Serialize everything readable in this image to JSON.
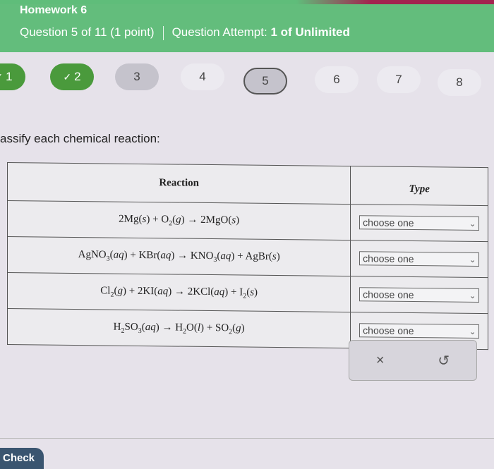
{
  "header": {
    "title": "Homework 6",
    "question_info": "Question 5 of 11 (1 point)",
    "attempt_label": "Question Attempt:",
    "attempt_value": "1 of Unlimited"
  },
  "question_nav": [
    {
      "label": "1",
      "state": "done",
      "check": "✓"
    },
    {
      "label": "2",
      "state": "done",
      "check": "✓"
    },
    {
      "label": "3",
      "state": "visited"
    },
    {
      "label": "4",
      "state": "plain"
    },
    {
      "label": "5",
      "state": "current"
    },
    {
      "label": "6",
      "state": "plain"
    },
    {
      "label": "7",
      "state": "plain"
    },
    {
      "label": "8",
      "state": "plain"
    }
  ],
  "instructions": "assify each chemical reaction:",
  "table": {
    "headers": {
      "reaction": "Reaction",
      "type": "Type"
    },
    "rows": [
      {
        "reaction": "2Mg(s) + O2(g) → 2MgO(s)",
        "type_value": "choose one"
      },
      {
        "reaction": "AgNO3(aq) + KBr(aq) → KNO3(aq) + AgBr(s)",
        "type_value": "choose one"
      },
      {
        "reaction": "Cl2(g) + 2KI(aq) → 2KCl(aq) + I2(s)",
        "type_value": "choose one"
      },
      {
        "reaction": "H2SO3(aq) → H2O(l) + SO2(g)",
        "type_value": "choose one"
      }
    ]
  },
  "actions": {
    "clear_icon": "×",
    "undo_icon": "↺"
  },
  "footer": {
    "check_label": "Check"
  },
  "colors": {
    "header_green": "#63bd7c",
    "done_green": "#4a9a3c",
    "check_button": "#3a5570"
  }
}
